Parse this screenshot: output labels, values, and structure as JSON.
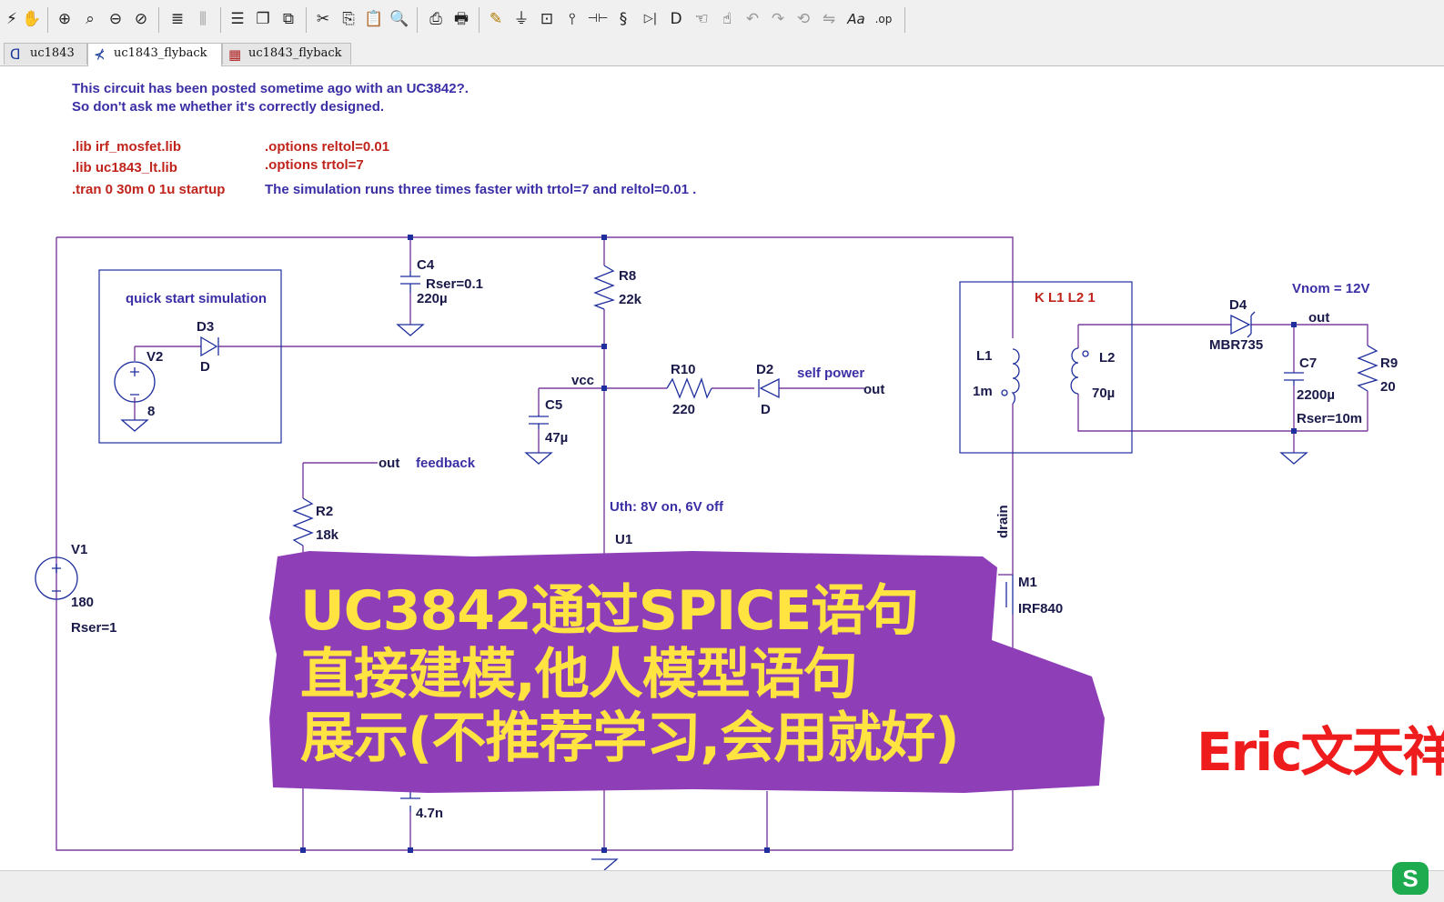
{
  "toolbar": {
    "buttons": [
      {
        "label": "⚡",
        "icon": "run-icon"
      },
      {
        "label": "✋",
        "icon": "pan-icon"
      },
      {
        "label": "⊕",
        "icon": "zoom-in-icon"
      },
      {
        "label": "⌕",
        "icon": "zoom-rect-icon"
      },
      {
        "label": "⊖",
        "icon": "zoom-out-icon"
      },
      {
        "label": "⊘",
        "icon": "zoom-fit-icon"
      },
      {
        "label": "≣",
        "icon": "tile-horizontal-icon"
      },
      {
        "label": "⫼",
        "icon": "tile-vertical-icon"
      },
      {
        "label": "☰",
        "icon": "cascade-icon"
      },
      {
        "label": "❐",
        "icon": "window-icon"
      },
      {
        "label": "⧉",
        "icon": "close-windows-icon"
      },
      {
        "label": "✂",
        "icon": "cut-icon"
      },
      {
        "label": "⎘",
        "icon": "copy-icon"
      },
      {
        "label": "📋",
        "icon": "paste-icon"
      },
      {
        "label": "🔍",
        "icon": "find-icon"
      },
      {
        "label": "⎙",
        "icon": "print-setup-icon"
      },
      {
        "label": "🖶",
        "icon": "print-icon"
      },
      {
        "label": "✎",
        "icon": "draw-wire-icon"
      },
      {
        "label": "⏚",
        "icon": "ground-icon"
      },
      {
        "label": "⊡",
        "icon": "label-net-icon"
      },
      {
        "label": "⫯",
        "icon": "resistor-icon"
      },
      {
        "label": "⊣⊢",
        "icon": "capacitor-icon"
      },
      {
        "label": "§",
        "icon": "inductor-icon"
      },
      {
        "label": "▷|",
        "icon": "diode-icon"
      },
      {
        "label": "D",
        "icon": "component-icon"
      },
      {
        "label": "☜",
        "icon": "move-icon"
      },
      {
        "label": "☝",
        "icon": "drag-icon"
      },
      {
        "label": "↶",
        "icon": "undo-icon"
      },
      {
        "label": "↷",
        "icon": "redo-icon"
      },
      {
        "label": "⟲",
        "icon": "rotate-icon"
      },
      {
        "label": "⇋",
        "icon": "mirror-icon"
      },
      {
        "label": "Aa",
        "icon": "text-icon"
      },
      {
        "label": ".op",
        "icon": "spice-directive-icon"
      }
    ]
  },
  "tabs": [
    {
      "label": "uc1843",
      "icon": "symbol-tab-icon"
    },
    {
      "label": "uc1843_flyback",
      "icon": "schematic-tab-icon"
    },
    {
      "label": "uc1843_flyback",
      "icon": "waveform-tab-icon"
    }
  ],
  "schematic": {
    "comments": {
      "line1": "This circuit has been posted sometime ago with an UC3842?.",
      "line2": "So don't ask me whether it's correctly designed.",
      "sim_speed": "The simulation runs  three times faster with trtol=7 and reltol=0.01 ."
    },
    "directives": {
      "lib1": ".lib irf_mosfet.lib",
      "lib2": ".lib uc1843_lt.lib",
      "tran": ".tran 0 30m 0 1u startup",
      "opt1": ".options reltol=0.01",
      "opt2": ".options trtol=7",
      "coupling": "K L1 L2 1"
    },
    "labels": {
      "quick_start": "quick start simulation",
      "vnom": "Vnom = 12V",
      "self_power": "self power",
      "feedback": "feedback",
      "uth": "Uth: 8V on, 6V off",
      "vcc": "vcc",
      "out_d2": "out",
      "out_r2": "out",
      "out_d4": "out",
      "drain": "drain"
    },
    "components": {
      "C4": {
        "name": "C4",
        "rser": "Rser=0.1",
        "value": "220µ"
      },
      "R8": {
        "name": "R8",
        "value": "22k"
      },
      "D3": {
        "name": "D3",
        "value": "D"
      },
      "V2": {
        "name": "V2",
        "value": "8"
      },
      "C5": {
        "name": "C5",
        "value": "47µ"
      },
      "R10": {
        "name": "R10",
        "value": "220"
      },
      "D2": {
        "name": "D2",
        "value": "D"
      },
      "R2": {
        "name": "R2",
        "value": "18k"
      },
      "U1": {
        "name": "U1"
      },
      "V1": {
        "name": "V1",
        "value": "180",
        "rser": "Rser=1"
      },
      "L1": {
        "name": "L1",
        "value": "1m"
      },
      "L2": {
        "name": "L2",
        "value": "70µ"
      },
      "D4": {
        "name": "D4",
        "value": "MBR735"
      },
      "C7": {
        "name": "C7",
        "value": "2200µ",
        "rser": "Rser=10m"
      },
      "R9": {
        "name": "R9",
        "value": "20"
      },
      "M1": {
        "name": "M1",
        "value": "IRF840"
      },
      "Cx": {
        "value": "4.7n"
      }
    }
  },
  "overlay": {
    "title_line1": "UC3842通过SPICE语句",
    "title_line2": "直接建模,他人模型语句",
    "title_line3": "展示(不推荐学习,会用就好)",
    "watermark": "Eric文天祥",
    "logo": "S"
  },
  "colors": {
    "wire": "#7b3fa0",
    "component": "#1f2f9e",
    "comment": "#3b2fa6",
    "directive": "#c0241c",
    "overlay_fill": "#8e3fb8",
    "overlay_text": "#ffe341",
    "watermark": "#ee1c1c"
  }
}
